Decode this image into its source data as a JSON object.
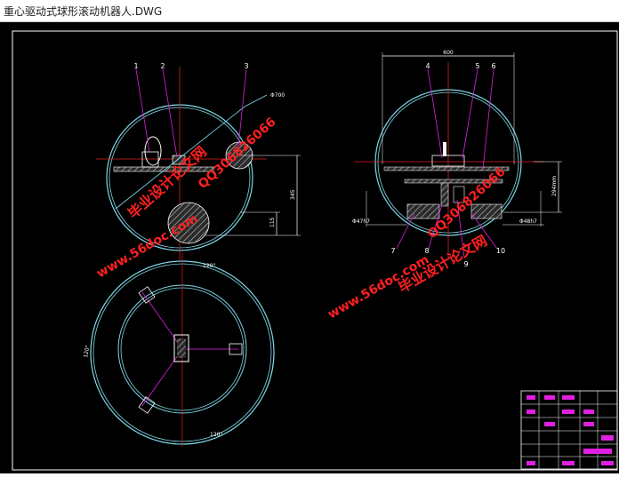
{
  "window": {
    "title": "重心驱动式球形滚动机器人.DWG"
  },
  "drawing": {
    "left_view": {
      "part_labels": [
        "1",
        "2",
        "3"
      ],
      "dim_diameter": "Φ700",
      "dim_height": "345",
      "dim_small": "115"
    },
    "right_view": {
      "part_labels_top": [
        "4",
        "5",
        "6"
      ],
      "part_labels_bottom": [
        "7",
        "8",
        "9",
        "10"
      ],
      "dim_width": "600",
      "dim_height": "294mm",
      "dim_left_bore": "Φ47h7",
      "dim_right_bore": "Φ48h7"
    },
    "bottom_view": {
      "angles": [
        "120°",
        "120°",
        "120°"
      ]
    }
  },
  "watermarks": {
    "site": "www.56doc.com",
    "qq": "QQ306826066",
    "cn": "毕业设计论文网"
  },
  "colors": {
    "background": "#000000",
    "outline": "#7fd8e8",
    "centerline": "#e02020",
    "leader": "#e020e0",
    "dimension": "#ffffff",
    "part": "#ffffff",
    "hatch": "#9a9a9a",
    "watermark": "#ff2020"
  }
}
